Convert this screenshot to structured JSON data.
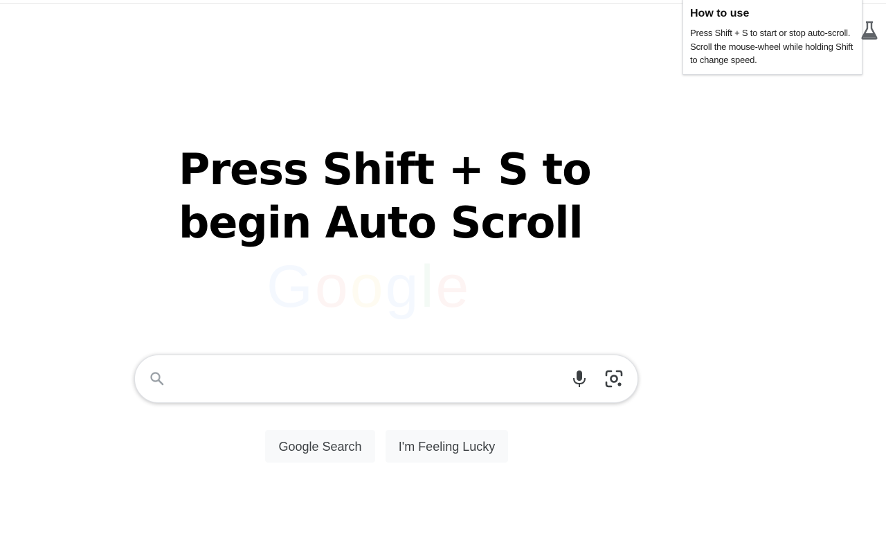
{
  "popup": {
    "title": "How to use",
    "body": "Press Shift + S to start or stop auto-scroll. Scroll the mouse-wheel while holding Shift to change speed."
  },
  "toolbar": {
    "labs_icon": "flask-icon"
  },
  "overlay": {
    "line1": "Press Shift + S to",
    "line2": "begin Auto Scroll"
  },
  "logo": {
    "letters": [
      "G",
      "o",
      "o",
      "g",
      "l",
      "e"
    ],
    "colors": [
      "#4285f4",
      "#ea4335",
      "#fbbc05",
      "#4285f4",
      "#34a853",
      "#ea4335"
    ]
  },
  "search": {
    "value": "",
    "placeholder": "",
    "icons": {
      "search": "search-icon",
      "voice": "microphone-icon",
      "image": "lens-camera-icon"
    }
  },
  "buttons": {
    "search": "Google Search",
    "lucky": "I'm Feeling Lucky"
  }
}
